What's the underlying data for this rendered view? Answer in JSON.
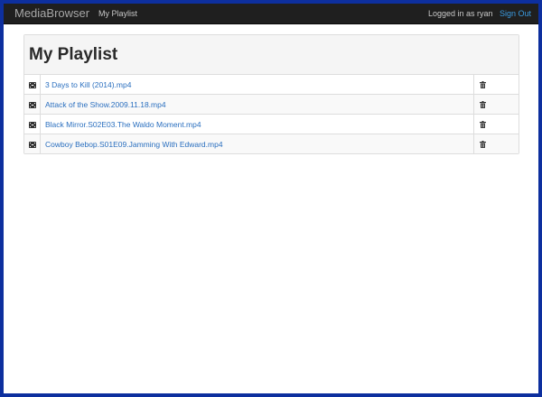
{
  "navbar": {
    "brand": "MediaBrowser",
    "link": "My Playlist",
    "logged_in_text": "Logged in as ryan",
    "sign_out": "Sign Out"
  },
  "panel": {
    "title": "My Playlist"
  },
  "playlist": {
    "items": [
      {
        "name": "3 Days to Kill (2014).mp4",
        "icon": "film-icon",
        "action_icon": "trash-icon"
      },
      {
        "name": "Attack of the Show.2009.11.18.mp4",
        "icon": "film-icon",
        "action_icon": "trash-icon"
      },
      {
        "name": "Black Mirror.S02E03.The Waldo Moment.mp4",
        "icon": "film-icon",
        "action_icon": "trash-icon"
      },
      {
        "name": "Cowboy Bebop.S01E09.Jamming With Edward.mp4",
        "icon": "film-icon",
        "action_icon": "trash-icon"
      }
    ]
  },
  "colors": {
    "background": "#0d2f9e",
    "navbar": "#1f1f1f",
    "link": "#2a6fbf",
    "sign_out": "#3a9be0",
    "panel_heading": "#f5f5f5",
    "border": "#dddddd"
  }
}
